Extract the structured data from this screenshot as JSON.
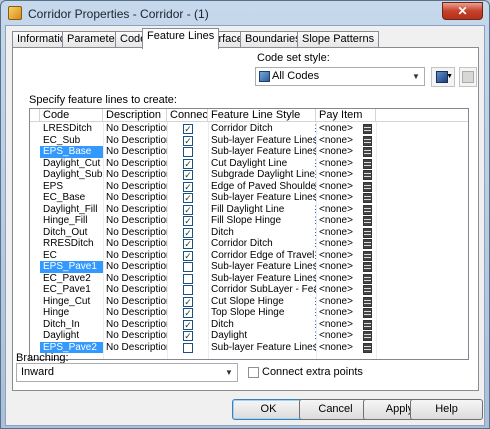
{
  "window": {
    "title": "Corridor Properties - Corridor - (1)",
    "close_label": "✕"
  },
  "tabs": [
    "Information",
    "Parameters",
    "Codes",
    "Feature Lines",
    "Surfaces",
    "Boundaries",
    "Slope Patterns"
  ],
  "active_tab": "Feature Lines",
  "code_set_style": {
    "label": "Code set style:",
    "value": "All Codes"
  },
  "specify_label": "Specify feature lines to create:",
  "columns": {
    "code": "Code",
    "description": "Description",
    "connect": "Connect",
    "style": "Feature Line Style",
    "pay_item": "Pay Item"
  },
  "rows": [
    {
      "code": "LRESDitch",
      "description": "No Description",
      "connect": true,
      "style": "Corridor Ditch",
      "pay_item": "<none>",
      "selected": false
    },
    {
      "code": "EC_Sub",
      "description": "No Description",
      "connect": true,
      "style": "Sub-layer Feature Lines",
      "pay_item": "<none>",
      "selected": false
    },
    {
      "code": "EPS_Base",
      "description": "No Description",
      "connect": false,
      "style": "Sub-layer Feature Lines",
      "pay_item": "<none>",
      "selected": true
    },
    {
      "code": "Daylight_Cut",
      "description": "No Description",
      "connect": true,
      "style": "Cut Daylight Line",
      "pay_item": "<none>",
      "selected": false
    },
    {
      "code": "Daylight_Sub",
      "description": "No Description",
      "connect": true,
      "style": "Subgrade Daylight Line",
      "pay_item": "<none>",
      "selected": false
    },
    {
      "code": "EPS",
      "description": "No Description",
      "connect": true,
      "style": "Edge of Paved Shoulder",
      "pay_item": "<none>",
      "selected": false
    },
    {
      "code": "EC_Base",
      "description": "No Description",
      "connect": true,
      "style": "Sub-layer Feature Lines",
      "pay_item": "<none>",
      "selected": false
    },
    {
      "code": "Daylight_Fill",
      "description": "No Description",
      "connect": true,
      "style": "Fill Daylight Line",
      "pay_item": "<none>",
      "selected": false
    },
    {
      "code": "Hinge_Fill",
      "description": "No Description",
      "connect": true,
      "style": "Fill Slope Hinge",
      "pay_item": "<none>",
      "selected": false
    },
    {
      "code": "Ditch_Out",
      "description": "No Description",
      "connect": true,
      "style": "Ditch",
      "pay_item": "<none>",
      "selected": false
    },
    {
      "code": "RRESDitch",
      "description": "No Description",
      "connect": true,
      "style": "Corridor Ditch",
      "pay_item": "<none>",
      "selected": false
    },
    {
      "code": "EC",
      "description": "No Description",
      "connect": true,
      "style": "Corridor Edge of Travel Way",
      "pay_item": "<none>",
      "selected": false
    },
    {
      "code": "EPS_Pave1",
      "description": "No Description",
      "connect": false,
      "style": "Sub-layer Feature Lines",
      "pay_item": "<none>",
      "selected": true
    },
    {
      "code": "EC_Pave2",
      "description": "No Description",
      "connect": false,
      "style": "Sub-layer Feature Lines",
      "pay_item": "<none>",
      "selected": false
    },
    {
      "code": "EC_Pave1",
      "description": "No Description",
      "connect": false,
      "style": "Corridor SubLayer - Feature Li",
      "pay_item": "<none>",
      "selected": false
    },
    {
      "code": "Hinge_Cut",
      "description": "No Description",
      "connect": true,
      "style": "Cut Slope Hinge",
      "pay_item": "<none>",
      "selected": false
    },
    {
      "code": "Hinge",
      "description": "No Description",
      "connect": true,
      "style": "Top Slope Hinge",
      "pay_item": "<none>",
      "selected": false
    },
    {
      "code": "Ditch_In",
      "description": "No Description",
      "connect": true,
      "style": "Ditch",
      "pay_item": "<none>",
      "selected": false
    },
    {
      "code": "Daylight",
      "description": "No Description",
      "connect": true,
      "style": "Daylight",
      "pay_item": "<none>",
      "selected": false
    },
    {
      "code": "EPS_Pave2",
      "description": "No Description",
      "connect": false,
      "style": "Sub-layer Feature Lines",
      "pay_item": "<none>",
      "selected": true
    }
  ],
  "branching": {
    "label": "Branching:",
    "value": "Inward"
  },
  "connect_extra": {
    "label": "Connect extra points",
    "checked": false
  },
  "buttons": {
    "ok": "OK",
    "cancel": "Cancel",
    "apply": "Apply",
    "help": "Help"
  },
  "check_mark": "✓"
}
